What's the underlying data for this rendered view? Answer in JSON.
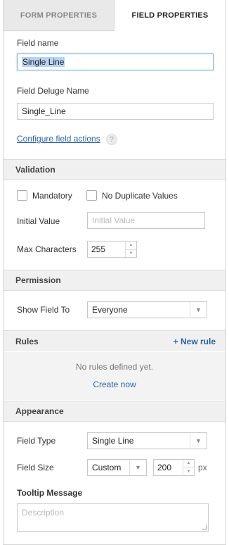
{
  "tabs": [
    {
      "label": "FORM PROPERTIES"
    },
    {
      "label": "FIELD PROPERTIES"
    }
  ],
  "field": {
    "name_label": "Field name",
    "name_value": "Single Line",
    "deluge_label": "Field Deluge Name",
    "deluge_value": "Single_Line",
    "configure_link": "Configure field actions",
    "help_glyph": "?"
  },
  "validation": {
    "title": "Validation",
    "mandatory_label": "Mandatory",
    "mandatory_checked": false,
    "no_duplicate_label": "No Duplicate Values",
    "no_duplicate_checked": false,
    "initial_value_label": "Initial Value",
    "initial_value_placeholder": "Initial Value",
    "max_chars_label": "Max Characters",
    "max_chars_value": "255"
  },
  "permission": {
    "title": "Permission",
    "show_field_label": "Show Field To",
    "show_field_value": "Everyone"
  },
  "rules": {
    "title": "Rules",
    "new_rule_label": "+ New rule",
    "empty_text": "No rules defined yet.",
    "create_now_label": "Create now"
  },
  "appearance": {
    "title": "Appearance",
    "field_type_label": "Field Type",
    "field_type_value": "Single Line",
    "field_size_label": "Field Size",
    "field_size_mode": "Custom",
    "field_size_value": "200",
    "field_size_unit": "px",
    "tooltip_label": "Tooltip Message",
    "tooltip_placeholder": "Description"
  },
  "colors": {
    "accent_link": "#2b63a9",
    "selection": "#b6d4f5"
  }
}
